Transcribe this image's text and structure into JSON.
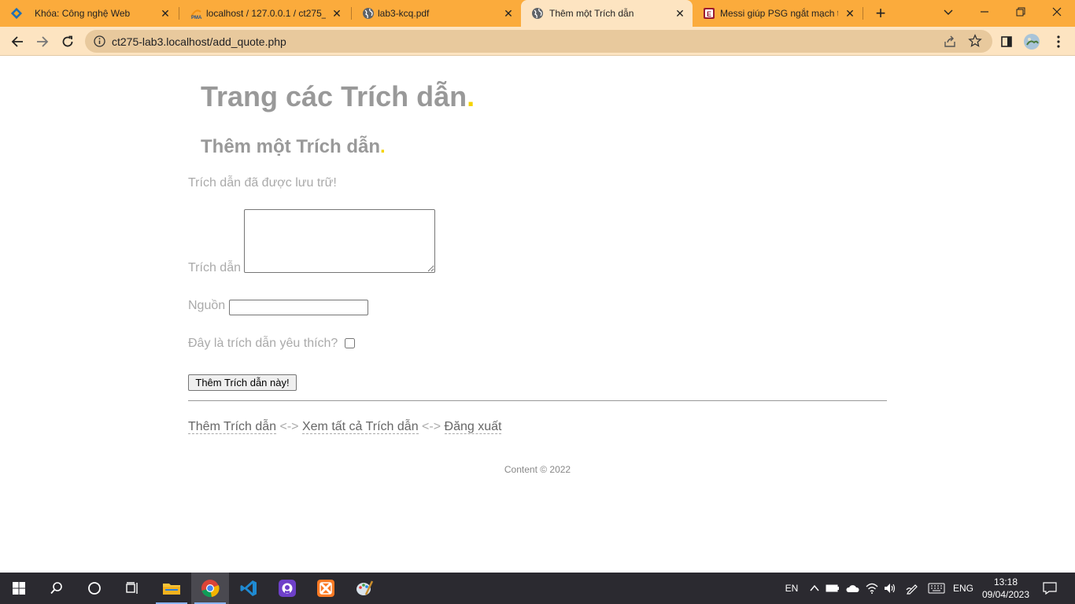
{
  "browser": {
    "tabs": [
      {
        "title": "Khóa: Công nghệ Web",
        "icon": "moodle-icon"
      },
      {
        "title": "localhost / 127.0.0.1 / ct275_",
        "icon": "phpmyadmin-icon"
      },
      {
        "title": "lab3-kcq.pdf",
        "icon": "globe-icon"
      },
      {
        "title": "Thêm một Trích dẫn",
        "icon": "globe-icon"
      },
      {
        "title": "Messi giúp PSG ngắt mạch th",
        "icon": "news-icon"
      }
    ],
    "active_tab_index": 3,
    "url": "ct275-lab3.localhost/add_quote.php"
  },
  "page": {
    "site_title": "Trang các Trích dẫn",
    "site_title_dot": ".",
    "page_heading": "Thêm một Trích dẫn",
    "page_heading_dot": ".",
    "status_message": "Trích dẫn đã được lưu trữ!",
    "form": {
      "quote_label": "Trích dẫn",
      "quote_value": "",
      "source_label": "Nguồn",
      "source_value": "",
      "favorite_label": "Đây là trích dẫn yêu thích?",
      "favorite_checked": false,
      "submit_label": "Thêm Trích dẫn này!"
    },
    "nav_links": {
      "add": "Thêm Trích dẫn",
      "separator": "<->",
      "view_all": "Xem tất cả Trích dẫn",
      "logout": "Đăng xuất"
    },
    "footer": "Content © 2022"
  },
  "taskbar": {
    "language_indicator": "EN",
    "input_language": "ENG",
    "time": "13:18",
    "date": "09/04/2023"
  },
  "colors": {
    "tab_strip": "#fbab3c",
    "toolbar": "#fde4c1",
    "accent_dot": "#f5d300",
    "heading_gray": "#999999",
    "taskbar": "#2b2a30"
  }
}
